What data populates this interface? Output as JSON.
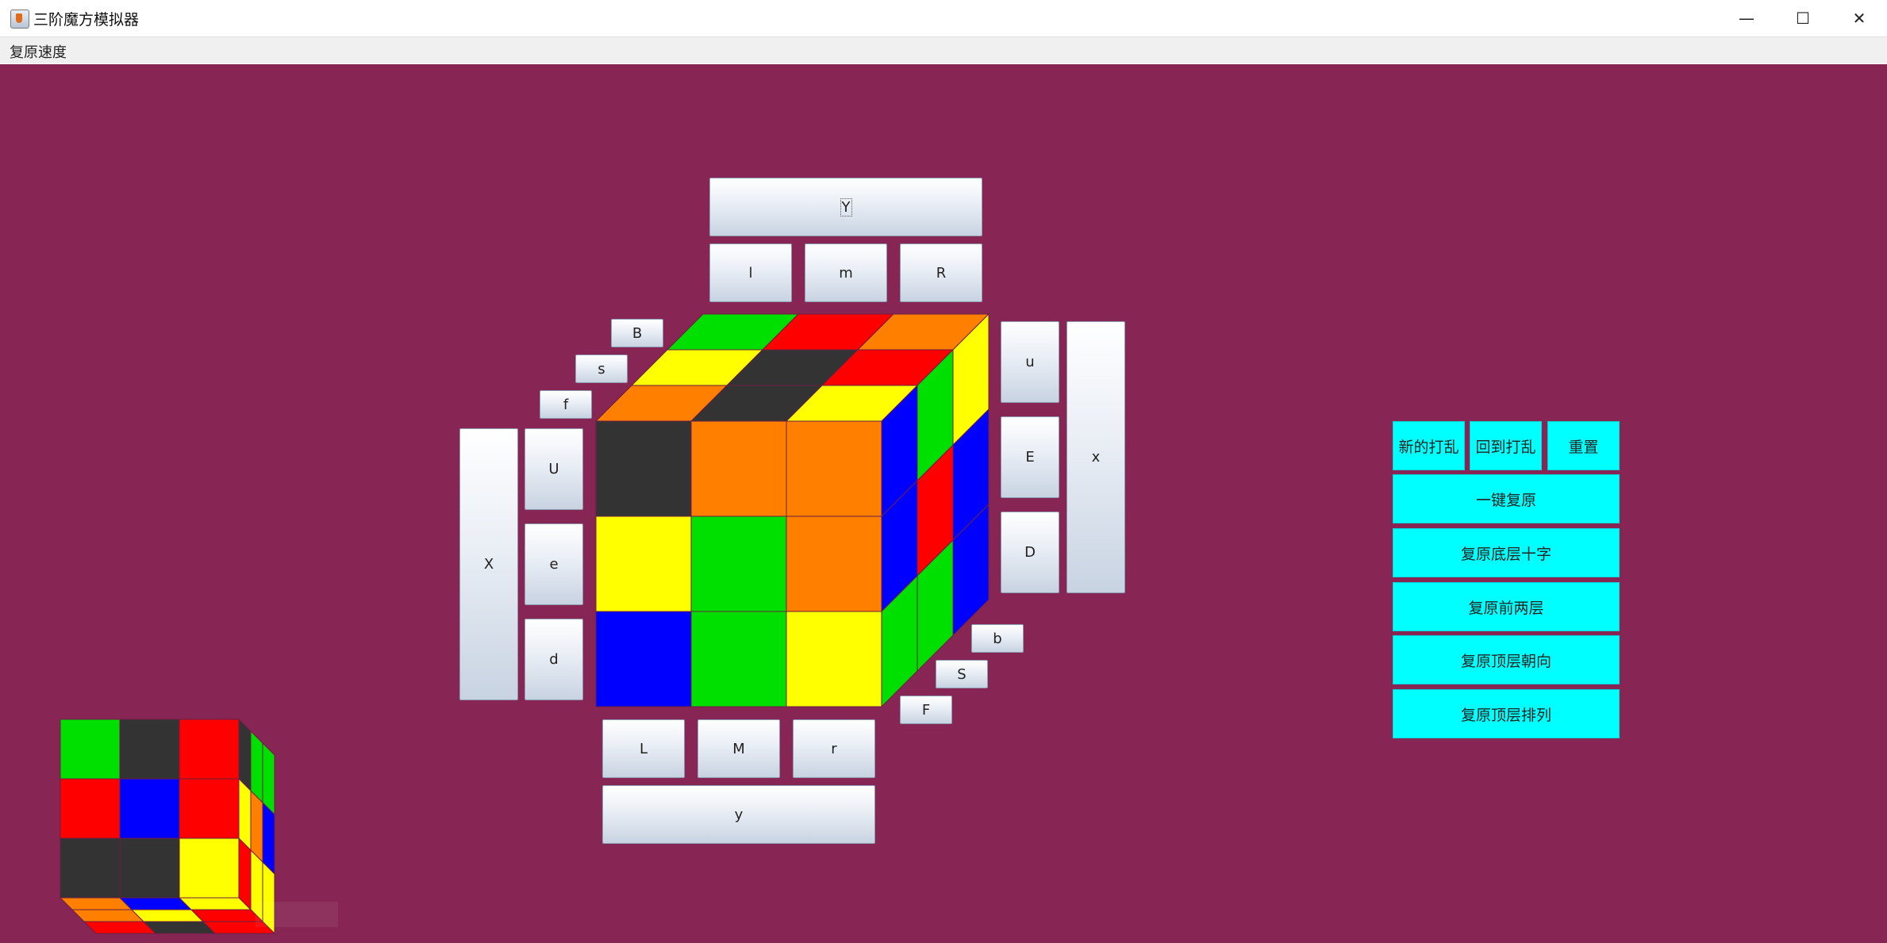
{
  "window": {
    "title": "三阶魔方模拟器",
    "controls": [
      "—",
      "☐",
      "✕"
    ]
  },
  "menu": {
    "speed_label": "复原速度"
  },
  "colors": {
    "background": "#872654",
    "G": "#00e000",
    "R": "#ff0000",
    "O": "#ff7f00",
    "Y": "#ffff00",
    "K": "#333333",
    "B": "#0000ff",
    "action_button": "#00ffff"
  },
  "move_buttons": {
    "Y": "Y",
    "l": "l",
    "m": "m",
    "R": "R",
    "B": "B",
    "s": "s",
    "f": "f",
    "u": "u",
    "E": "E",
    "D": "D",
    "x": "x",
    "X": "X",
    "U": "U",
    "e": "e",
    "d": "d",
    "b": "b",
    "S": "S",
    "F": "F",
    "L": "L",
    "M": "M",
    "r": "r",
    "y": "y"
  },
  "actions": {
    "new_scramble": "新的打乱",
    "back_to_scramble": "回到打乱",
    "reset": "重置",
    "one_key_solve": "一键复原",
    "solve_cross": "复原底层十字",
    "solve_f2l": "复原前两层",
    "solve_oll": "复原顶层朝向",
    "solve_pll": "复原顶层排列"
  },
  "cube": {
    "top_face": [
      [
        "G",
        "R",
        "O"
      ],
      [
        "Y",
        "K",
        "R"
      ],
      [
        "O",
        "K",
        "Y"
      ]
    ],
    "front_face": [
      [
        "K",
        "O",
        "O"
      ],
      [
        "Y",
        "G",
        "O"
      ],
      [
        "B",
        "G",
        "Y"
      ]
    ],
    "right_face": [
      [
        "B",
        "G",
        "Y"
      ],
      [
        "B",
        "R",
        "B"
      ],
      [
        "G",
        "G",
        "B"
      ]
    ]
  },
  "mini_cube": {
    "front_face": [
      [
        "G",
        "K",
        "R"
      ],
      [
        "R",
        "B",
        "R"
      ],
      [
        "K",
        "K",
        "Y"
      ]
    ],
    "right_face": [
      [
        "K",
        "G",
        "G"
      ],
      [
        "Y",
        "O",
        "B"
      ],
      [
        "R",
        "Y",
        "Y"
      ]
    ],
    "bottom_face": [
      [
        "O",
        "B",
        "Y"
      ],
      [
        "O",
        "Y",
        "R"
      ],
      [
        "R",
        "K",
        "R"
      ]
    ]
  }
}
